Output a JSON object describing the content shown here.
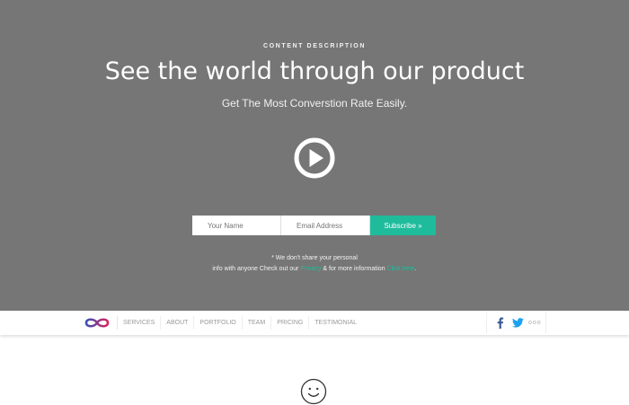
{
  "hero": {
    "eyebrow": "CONTENT DESCRIPTION",
    "headline": "See the world through our product",
    "subline": "Get The Most Converstion Rate Easily.",
    "background_color": "#767676",
    "accent_color": "#1fbc9c"
  },
  "form": {
    "name_placeholder": "Your Name",
    "email_placeholder": "Email Address",
    "subscribe_label": "Subscribe »"
  },
  "note": {
    "line1": "* We don't share your personal",
    "line2_prefix": "info with anyone Check out our",
    "link1": "Privacy",
    "line2_mid": "& for more information",
    "link2": "Click here",
    "line2_end": "."
  },
  "nav": {
    "items": [
      {
        "label": "SERVICES"
      },
      {
        "label": "ABOUT"
      },
      {
        "label": "PORTFOLIO"
      },
      {
        "label": "TEAM"
      },
      {
        "label": "PRICING"
      },
      {
        "label": "TESTIMONIAL"
      }
    ],
    "more": "ooo"
  },
  "icons": {
    "play": "play-circle-icon",
    "logo": "infinity-logo",
    "facebook": "facebook-icon",
    "twitter": "twitter-icon",
    "smiley": "smiley-icon"
  }
}
